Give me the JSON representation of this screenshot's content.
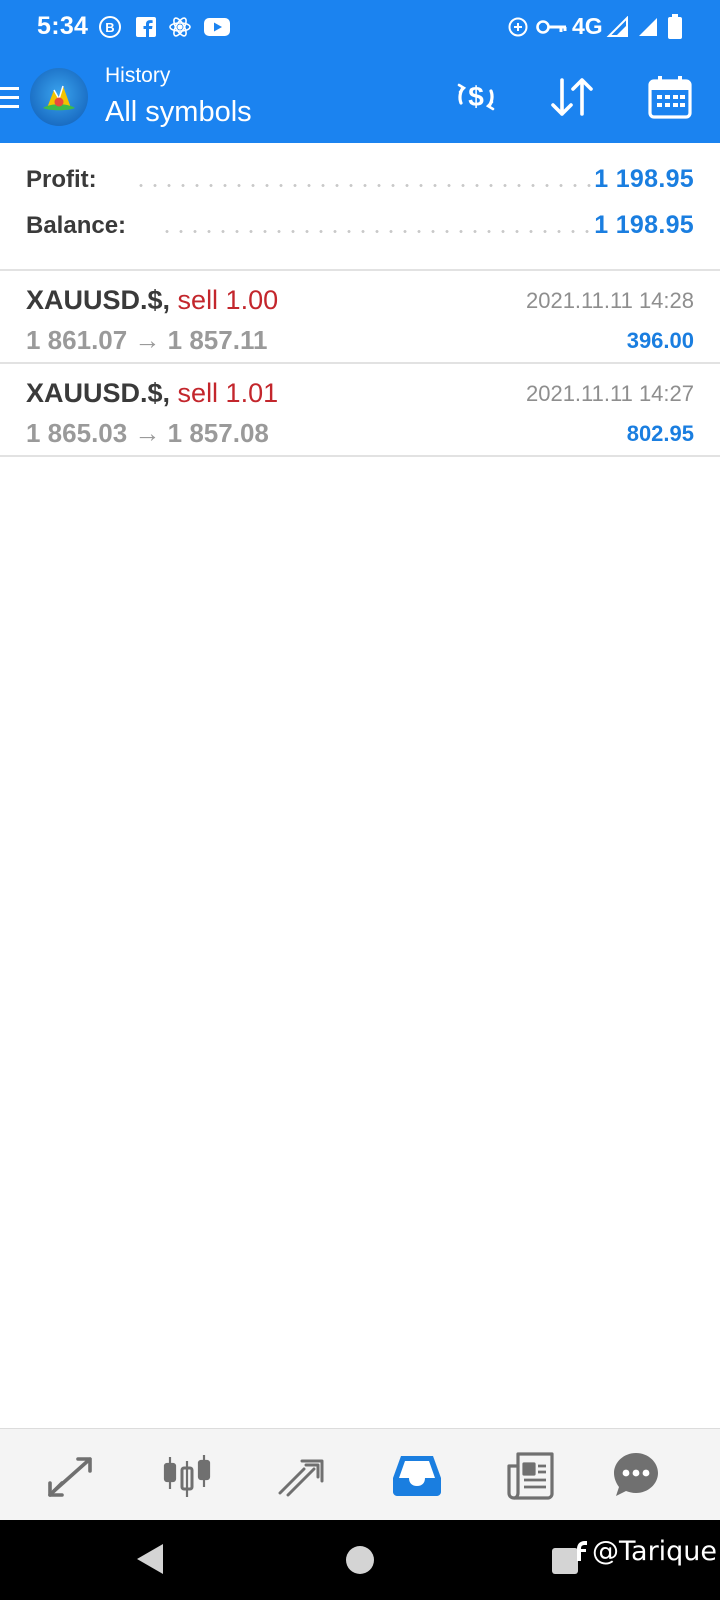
{
  "status_bar": {
    "time": "5:34",
    "network": "4G"
  },
  "app_bar": {
    "title_top": "History",
    "title_main": "All symbols",
    "accent_color": "#1b83f0"
  },
  "summary": {
    "profit_label": "Profit:",
    "profit_value": "1 198.95",
    "balance_label": "Balance:",
    "balance_value": "1 198.95"
  },
  "deals": [
    {
      "symbol": "XAUUSD.$,",
      "type": "sell 1.00",
      "prices": "1 861.07 → 1 857.11",
      "time": "2021.11.11 14:28",
      "profit": "396.00"
    },
    {
      "symbol": "XAUUSD.$,",
      "type": "sell 1.01",
      "prices": "1 865.03 → 1 857.08",
      "time": "2021.11.11 14:27",
      "profit": "802.95"
    }
  ],
  "bottom_nav": {
    "items": [
      "quotes-icon",
      "chart-icon",
      "trade-icon",
      "history-icon",
      "news-icon",
      "chat-icon"
    ],
    "active": "history-icon",
    "active_color": "#1a7ee0"
  },
  "watermark": "@Tarique"
}
